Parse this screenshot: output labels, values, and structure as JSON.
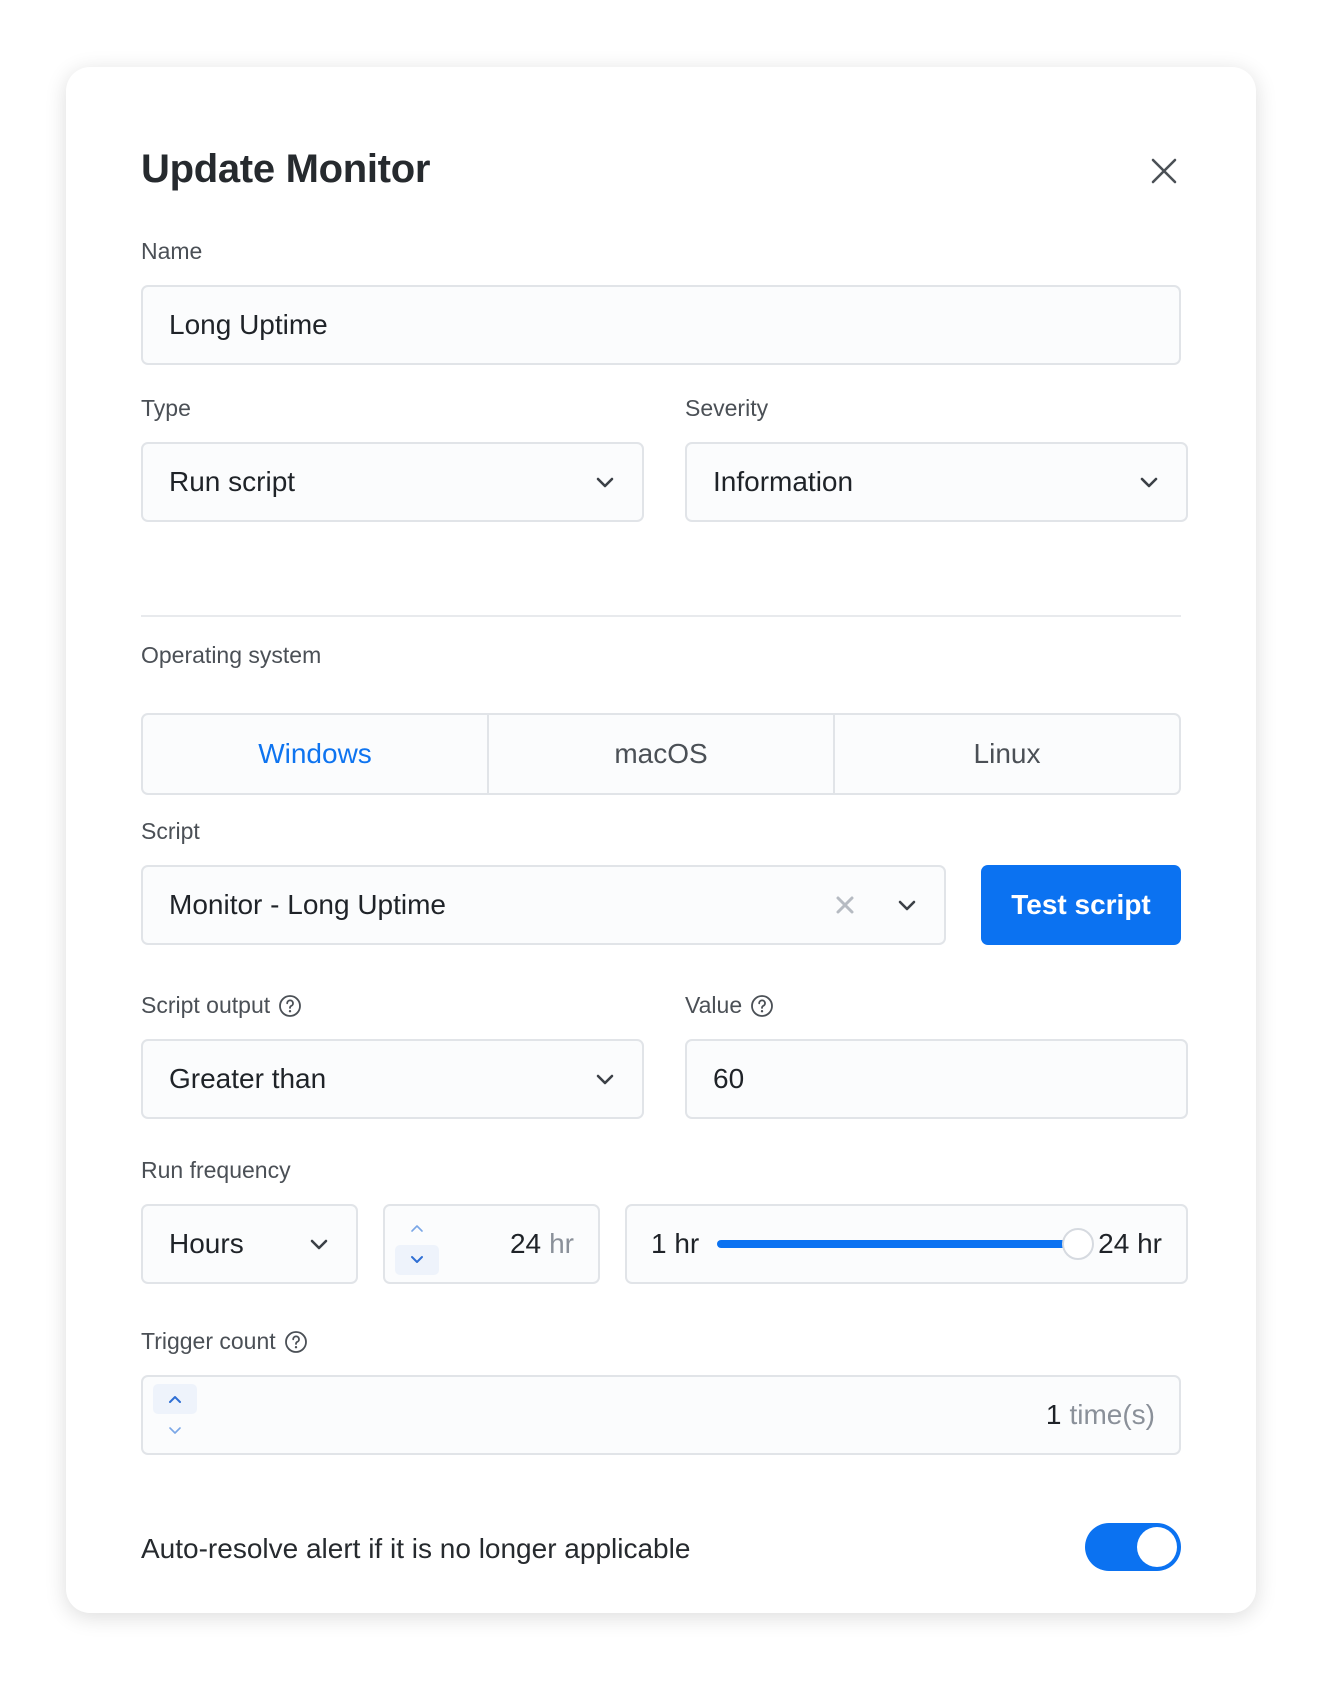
{
  "dialog": {
    "title": "Update Monitor"
  },
  "name": {
    "label": "Name",
    "value": "Long Uptime"
  },
  "type": {
    "label": "Type",
    "value": "Run script"
  },
  "severity": {
    "label": "Severity",
    "value": "Information"
  },
  "os": {
    "label": "Operating system",
    "options": [
      "Windows",
      "macOS",
      "Linux"
    ],
    "selected": "Windows"
  },
  "script": {
    "label": "Script",
    "value": "Monitor - Long Uptime",
    "test_button": "Test script"
  },
  "script_output": {
    "label": "Script output",
    "value": "Greater than"
  },
  "value_field": {
    "label": "Value",
    "value": "60"
  },
  "run_frequency": {
    "label": "Run frequency",
    "unit_select": "Hours",
    "amount": "24",
    "amount_unit": "hr",
    "slider_min": "1 hr",
    "slider_max": "24 hr",
    "slider_value": 24
  },
  "trigger_count": {
    "label": "Trigger count",
    "value": "1",
    "unit": "time(s)"
  },
  "auto_resolve": {
    "label": "Auto-resolve alert if it is no longer applicable",
    "enabled": true
  },
  "colors": {
    "accent": "#0b72f1",
    "border": "#e1e4e8",
    "muted_text": "#8a9099"
  },
  "icons": {
    "close": "close-icon",
    "chevron": "chevron-down-icon",
    "help": "help-circle-icon",
    "clear": "clear-icon",
    "step_up": "chevron-up-icon",
    "step_down": "chevron-down-icon"
  }
}
